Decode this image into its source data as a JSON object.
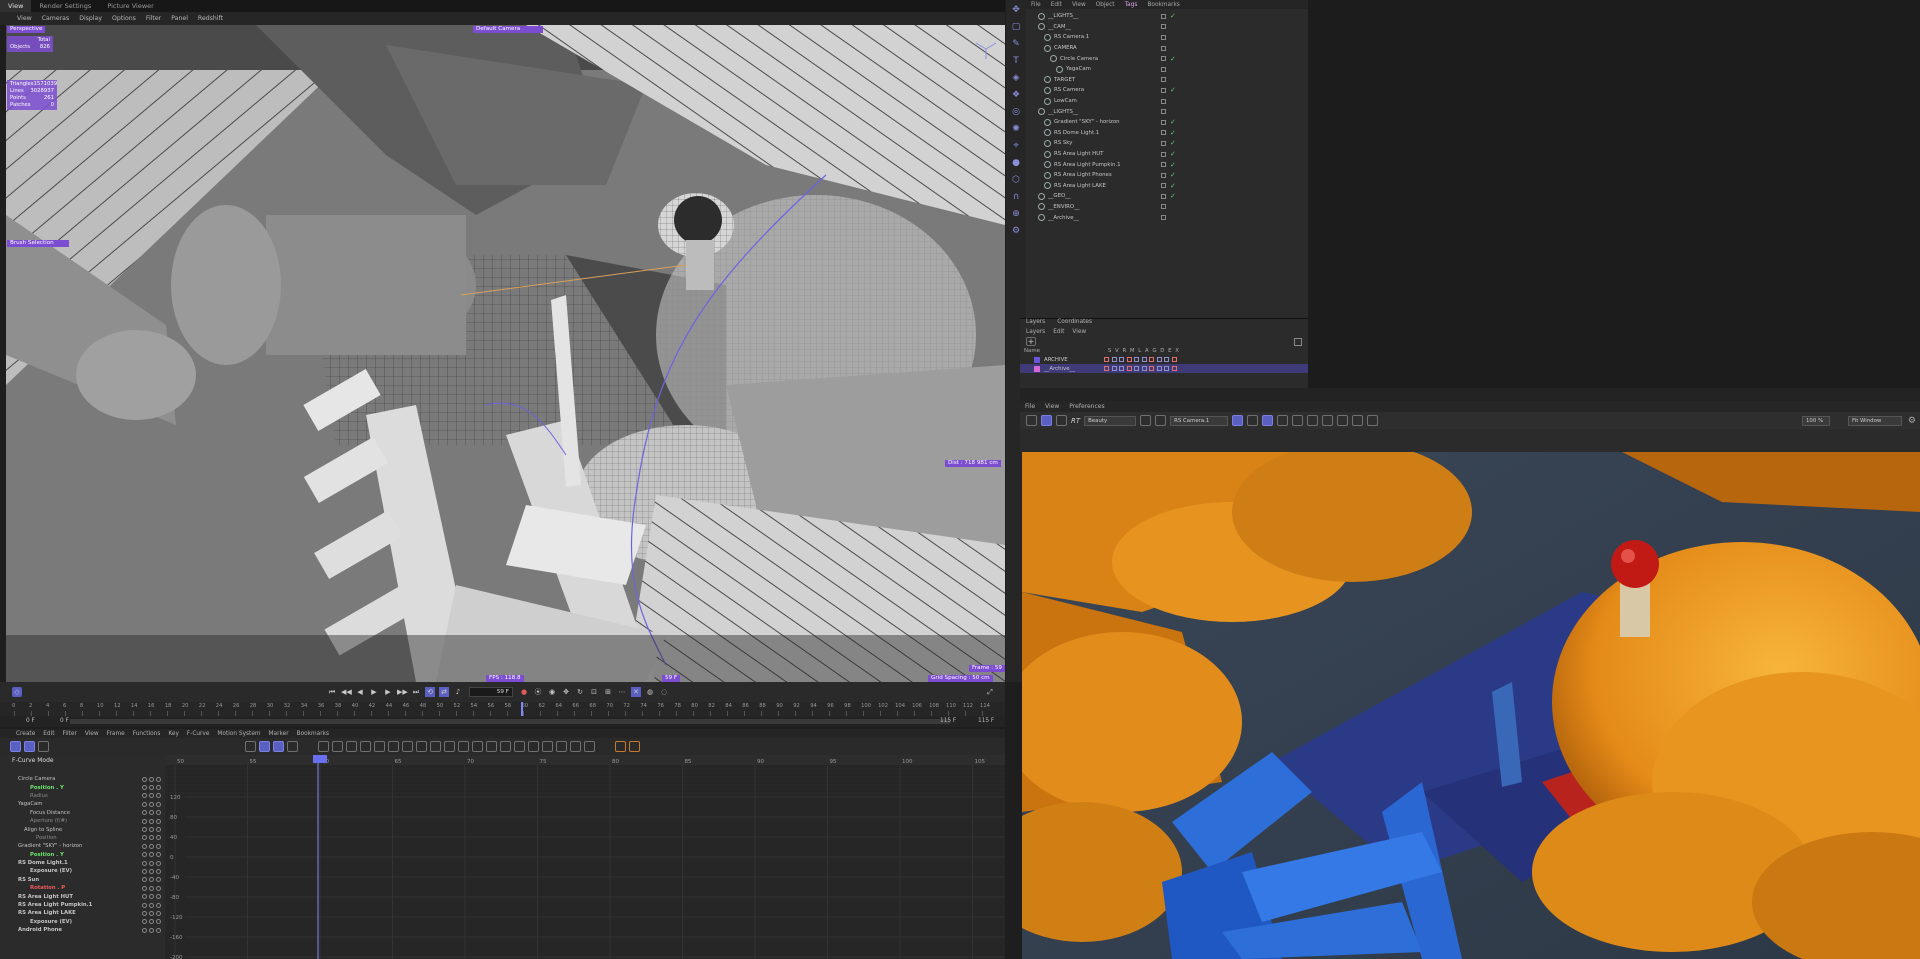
{
  "top_tabs": [
    "View",
    "Render Settings",
    "Picture Viewer"
  ],
  "viewport_menu": [
    "View",
    "Cameras",
    "Display",
    "Options",
    "Filter",
    "Panel",
    "Redshift"
  ],
  "viewport": {
    "projection": "Perspective",
    "camera": "Default Camera",
    "stats_header": "Total",
    "objects_label": "Objects",
    "objects_value": "826",
    "triangles_label": "Triangles",
    "triangles_value": "1571039",
    "lines_label": "Lines",
    "lines_value": "3028937",
    "points_label": "Points",
    "points_value": "261",
    "patches_label": "Patches",
    "patches_value": "0",
    "selection_mode": "Brush Selection",
    "dist": "Dist : 718 981 cm",
    "fps": "FPS : 118.8",
    "frame_marker": "59 F",
    "frame": "Frame : 59",
    "grid_spacing": "Grid Spacing : 50 cm"
  },
  "object_manager": {
    "menu": [
      "File",
      "Edit",
      "View",
      "Object",
      "Tags",
      "Bookmarks"
    ],
    "active_menu": "Tags",
    "objects": [
      {
        "name": "__LIGHTS__",
        "depth": 0,
        "check": true
      },
      {
        "name": "__CAM__",
        "depth": 0,
        "check": false
      },
      {
        "name": "RS Camera.1",
        "depth": 1,
        "check": false
      },
      {
        "name": "CAMERA",
        "depth": 1,
        "check": false
      },
      {
        "name": "Circle Camera",
        "depth": 2,
        "check": true
      },
      {
        "name": "YagaCam",
        "depth": 3,
        "check": false
      },
      {
        "name": "TARGET",
        "depth": 1,
        "check": false
      },
      {
        "name": "RS Camera",
        "depth": 1,
        "check": true
      },
      {
        "name": "LowCam",
        "depth": 1,
        "check": false
      },
      {
        "name": "__LIGHTS__",
        "depth": 0,
        "check": false
      },
      {
        "name": "Gradient \"SKY\" - horizon",
        "depth": 1,
        "check": true
      },
      {
        "name": "RS Dome Light.1",
        "depth": 1,
        "check": true
      },
      {
        "name": "RS Sky",
        "depth": 1,
        "check": true
      },
      {
        "name": "RS Area Light HUT",
        "depth": 1,
        "check": true
      },
      {
        "name": "RS Area Light Pumpkin.1",
        "depth": 1,
        "check": true
      },
      {
        "name": "RS Area Light Phones",
        "depth": 1,
        "check": true
      },
      {
        "name": "RS Area Light LAKE",
        "depth": 1,
        "check": true
      },
      {
        "name": "__GEO__",
        "depth": 0,
        "check": true
      },
      {
        "name": "__ENVIRO__",
        "depth": 0,
        "check": false
      },
      {
        "name": "__Archive__",
        "depth": 0,
        "check": false
      }
    ]
  },
  "layers": {
    "tabs": [
      "Layers",
      "Coordinates"
    ],
    "menu": [
      "Layers",
      "Edit",
      "View"
    ],
    "columns": "Name   S V R M L A G D E X",
    "name_header": "Name",
    "rows": [
      {
        "name": "ARCHIVE",
        "color": "#6b56d6",
        "selected": false
      },
      {
        "name": "__Archive__",
        "color": "#d667d6",
        "selected": true
      }
    ]
  },
  "render_view": {
    "menu": [
      "File",
      "View",
      "Preferences"
    ],
    "rt_label": "RT",
    "aov": "Beauty",
    "camera_select": "RS Camera.1",
    "zoom": "100 %",
    "fit": "Fit Window"
  },
  "timeline": {
    "current_frame": "59 F",
    "ruler_ticks": [
      "0",
      "2",
      "4",
      "6",
      "8",
      "10",
      "12",
      "14",
      "16",
      "18",
      "20",
      "22",
      "24",
      "26",
      "28",
      "30",
      "32",
      "34",
      "36",
      "38",
      "40",
      "42",
      "44",
      "46",
      "48",
      "50",
      "52",
      "54",
      "56",
      "58",
      "60",
      "62",
      "64",
      "66",
      "68",
      "70",
      "72",
      "74",
      "76",
      "78",
      "80",
      "82",
      "84",
      "86",
      "88",
      "90",
      "92",
      "94",
      "96",
      "98",
      "100",
      "102",
      "104",
      "106",
      "108",
      "110",
      "112",
      "114"
    ],
    "start_a": "0 F",
    "start_b": "0 F",
    "end_a": "115 F",
    "end_b": "115 F",
    "menu": [
      "Create",
      "Edit",
      "Filter",
      "View",
      "Frame",
      "Functions",
      "Key",
      "F-Curve",
      "Motion System",
      "Marker",
      "Bookmarks"
    ],
    "mode": "F-Curve Mode",
    "graph_x_ticks": [
      "50",
      "55",
      "60",
      "65",
      "70",
      "75",
      "80",
      "85",
      "90",
      "95",
      "100",
      "105"
    ],
    "graph_y_ticks": [
      "120",
      "80",
      "40",
      "0",
      "-40",
      "-80",
      "-120",
      "-160",
      "-200"
    ],
    "tracks": [
      {
        "name": "Circle Camera",
        "style": "normal",
        "indent": 1
      },
      {
        "name": "Position . Y",
        "style": "green",
        "indent": 3
      },
      {
        "name": "Radius",
        "style": "dim",
        "indent": 3
      },
      {
        "name": "YagaCam",
        "style": "normal",
        "indent": 1
      },
      {
        "name": "Focus Distance",
        "style": "normal",
        "indent": 3
      },
      {
        "name": "Aperture (f/#)",
        "style": "dim",
        "indent": 3
      },
      {
        "name": "Align to Spline",
        "style": "normal",
        "indent": 2
      },
      {
        "name": "Position",
        "style": "dim",
        "indent": 4
      },
      {
        "name": "Gradient \"SKY\" - horizon",
        "style": "normal",
        "indent": 1
      },
      {
        "name": "Position . Y",
        "style": "green",
        "indent": 3
      },
      {
        "name": "RS Dome Light.1",
        "style": "bold",
        "indent": 1
      },
      {
        "name": "Exposure (EV)",
        "style": "bold",
        "indent": 3
      },
      {
        "name": "RS Sun",
        "style": "bold",
        "indent": 1
      },
      {
        "name": "Rotation . P",
        "style": "red",
        "indent": 3
      },
      {
        "name": "RS Area Light HUT",
        "style": "bold",
        "indent": 1
      },
      {
        "name": "RS Area Light Pumpkin.1",
        "style": "bold",
        "indent": 1
      },
      {
        "name": "RS Area Light LAKE",
        "style": "bold",
        "indent": 1
      },
      {
        "name": "Exposure (EV)",
        "style": "bold",
        "indent": 3
      },
      {
        "name": "Android Phone",
        "style": "bold",
        "indent": 1
      }
    ]
  },
  "colors": {
    "accent": "#7c4dd1",
    "selection_blue": "#5a5fc2",
    "check_green": "#5ecf5e"
  }
}
